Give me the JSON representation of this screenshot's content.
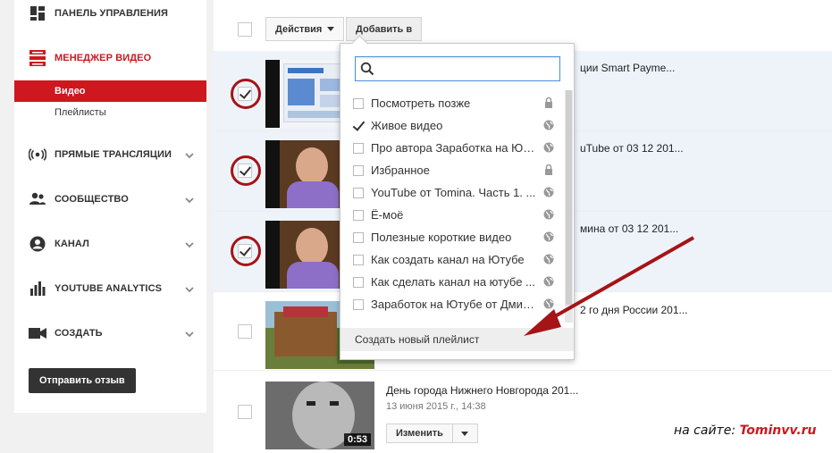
{
  "sidebar": {
    "dashboard": "ПАНЕЛЬ УПРАВЛЕНИЯ",
    "video_manager": "МЕНЕДЖЕР ВИДЕО",
    "sub_videos": "Видео",
    "sub_playlists": "Плейлисты",
    "live": "ПРЯМЫЕ ТРАНСЛЯЦИИ",
    "community": "СООБЩЕСТВО",
    "channel": "КАНАЛ",
    "analytics": "YOUTUBE ANALYTICS",
    "create": "СОЗДАТЬ",
    "feedback": "Отправить отзыв"
  },
  "toolbar": {
    "actions": "Действия",
    "add_to": "Добавить в"
  },
  "dropdown": {
    "search_placeholder": "",
    "items": [
      {
        "label": "Посмотреть позже",
        "checked": false,
        "icon": "lock-icon"
      },
      {
        "label": "Живое видео",
        "checked": true,
        "icon": "globe-icon"
      },
      {
        "label": "Про автора Заработка на Ютуб...",
        "checked": false,
        "icon": "globe-icon"
      },
      {
        "label": "Избранное",
        "checked": false,
        "icon": "lock-icon"
      },
      {
        "label": "YouTube от Tomina. Часть 1. ...",
        "checked": false,
        "icon": "globe-icon"
      },
      {
        "label": "Ё-моё",
        "checked": false,
        "icon": "globe-icon"
      },
      {
        "label": "Полезные короткие видео",
        "checked": false,
        "icon": "globe-icon"
      },
      {
        "label": "Как создать канал на Ютубе",
        "checked": false,
        "icon": "globe-icon"
      },
      {
        "label": "Как сделать канал на ютубе ...",
        "checked": false,
        "icon": "globe-icon"
      },
      {
        "label": "Заработок на Ютубе от Дмит...",
        "checked": false,
        "icon": "globe-icon"
      }
    ],
    "create_playlist": "Создать новый плейлист"
  },
  "videos": [
    {
      "title_tail": "ции Smart Payme..."
    },
    {
      "title_tail": "uTube от 03 12 201..."
    },
    {
      "title_tail": "мина от 03 12 201..."
    },
    {
      "title_tail": "2 го дня России 201..."
    },
    {
      "title": "День города Нижнего Новгорода 201...",
      "date": "13 июня 2015 г., 14:38",
      "duration": "0:53",
      "edit": "Изменить"
    }
  ],
  "watermark": {
    "prefix": "на сайте:",
    "site": "Tominvv.ru"
  },
  "colors": {
    "accent": "#cc181e",
    "selected_row": "#eef3fa",
    "annotation": "#a51417"
  }
}
